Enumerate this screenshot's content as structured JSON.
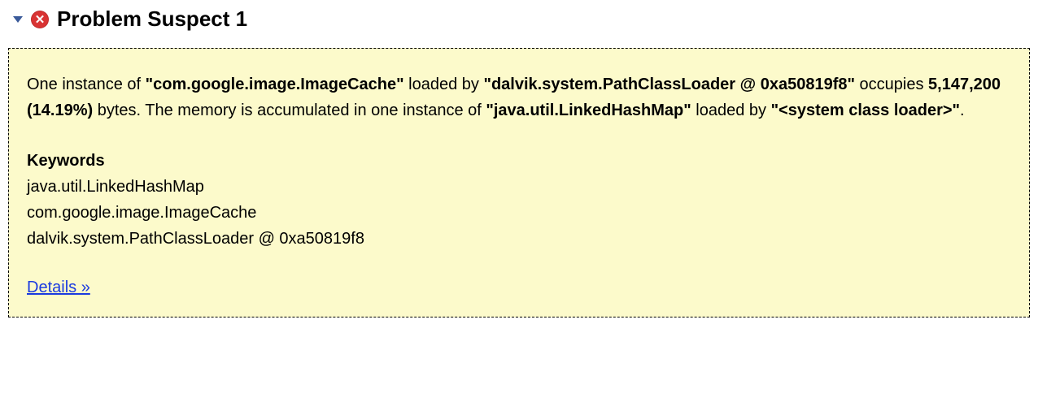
{
  "header": {
    "title": "Problem Suspect 1",
    "error_glyph": "✕"
  },
  "suspect": {
    "desc_prefix": "One instance of ",
    "class_quoted": "\"com.google.image.ImageCache\"",
    "desc_loaded_by": " loaded by ",
    "loader_quoted": "\"dalvik.system.PathClassLoader @ 0xa50819f8\"",
    "desc_occupies": " occupies ",
    "bytes_pct": "5,147,200 (14.19%)",
    "desc_mid": " bytes. The memory is accumulated in one instance of ",
    "accumulated_quoted": "\"java.util.LinkedHashMap\"",
    "desc_loaded_by2": " loaded by ",
    "sys_loader_quoted": "\"<system class loader>\"",
    "desc_end": ".",
    "keywords_heading": "Keywords",
    "keywords": {
      "k0": "java.util.LinkedHashMap",
      "k1": "com.google.image.ImageCache",
      "k2": "dalvik.system.PathClassLoader @ 0xa50819f8"
    },
    "details_label": "Details »"
  }
}
